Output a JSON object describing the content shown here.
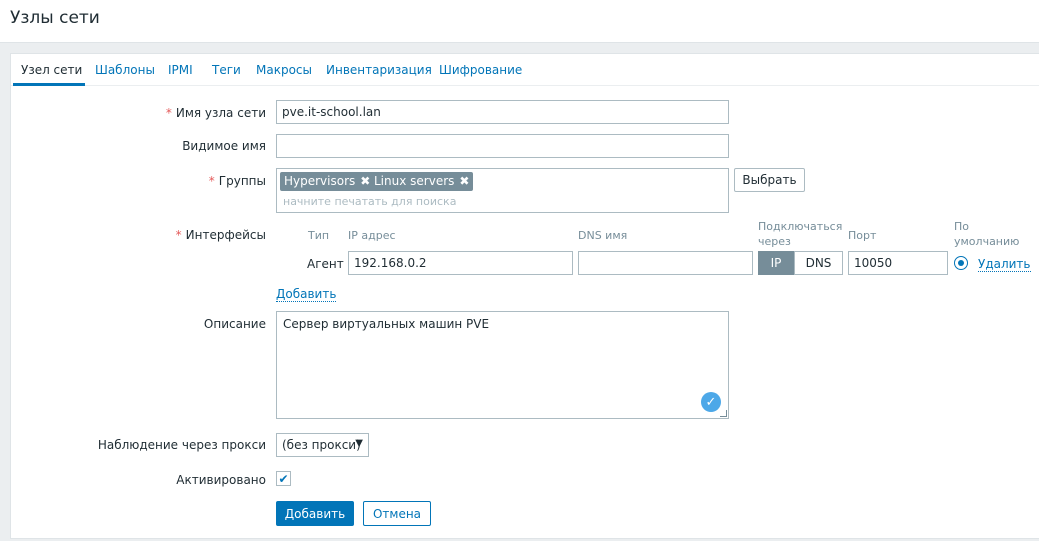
{
  "page": {
    "title": "Узлы сети"
  },
  "tabs": [
    {
      "label": "Узел сети",
      "active": true
    },
    {
      "label": "Шаблоны"
    },
    {
      "label": "IPMI"
    },
    {
      "label": "Теги"
    },
    {
      "label": "Макросы"
    },
    {
      "label": "Инвентаризация"
    },
    {
      "label": "Шифрование"
    }
  ],
  "form": {
    "required_mark": "*",
    "host_name": {
      "label": "Имя узла сети",
      "value": "pve.it-school.lan"
    },
    "visible_name": {
      "label": "Видимое имя",
      "value": ""
    },
    "groups": {
      "label": "Группы",
      "chips": [
        "Hypervisors",
        "Linux servers"
      ],
      "remove_glyph": "✖",
      "placeholder": "начните печатать для поиска",
      "select_button": "Выбрать"
    },
    "interfaces": {
      "label": "Интерфейсы",
      "headers": {
        "type": "Тип",
        "ip": "IP адрес",
        "dns": "DNS имя",
        "connect_via_1": "Подключаться",
        "connect_via_2": "через",
        "port": "Порт",
        "default_1": "По",
        "default_2": "умолчанию"
      },
      "row": {
        "type": "Агент",
        "ip": "192.168.0.2",
        "dns": "",
        "connect_ip": "IP",
        "connect_dns": "DNS",
        "port": "10050",
        "remove": "Удалить"
      },
      "add_link": "Добавить"
    },
    "description": {
      "label": "Описание",
      "value": "Сервер виртуальных машин PVE"
    },
    "proxy": {
      "label": "Наблюдение через прокси",
      "value": "(без прокси)",
      "arrow": "▼"
    },
    "enabled": {
      "label": "Активировано",
      "checked": true,
      "check_glyph": "✔"
    },
    "buttons": {
      "add": "Добавить",
      "cancel": "Отмена"
    }
  },
  "colors": {
    "accent": "#0275b8",
    "required": "#e45959",
    "chip": "#768d99",
    "background": "#ebeef0"
  }
}
